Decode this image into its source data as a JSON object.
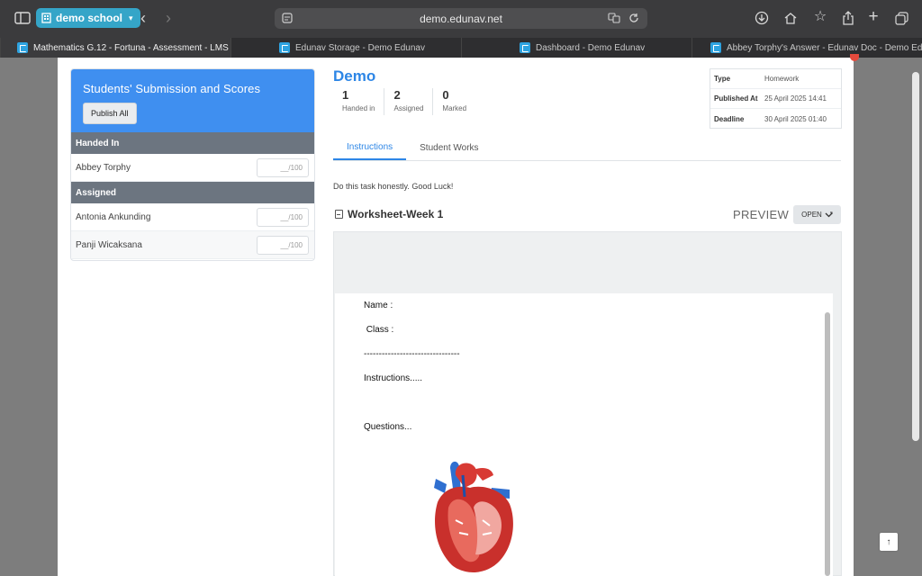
{
  "browser": {
    "profile_label": "demo school",
    "url": "demo.edunav.net",
    "tabs": [
      {
        "label": "Mathematics G.12 - Fortuna - Assessment - LMS -..."
      },
      {
        "label": "Edunav Storage - Demo Edunav"
      },
      {
        "label": "Dashboard - Demo Edunav"
      },
      {
        "label": "Abbey Torphy's Answer - Edunav Doc - Demo Edu..."
      }
    ]
  },
  "panel": {
    "title": "Students' Submission and Scores",
    "publish_label": "Publish All",
    "groups": [
      {
        "label": "Handed In",
        "students": [
          {
            "name": "Abbey Torphy",
            "score": "__/100"
          }
        ]
      },
      {
        "label": "Assigned",
        "students": [
          {
            "name": "Antonia Ankunding",
            "score": "__/100"
          },
          {
            "name": "Panji Wicaksana",
            "score": "__/100"
          }
        ]
      }
    ]
  },
  "assessment": {
    "title": "Demo",
    "stats": [
      {
        "value": "1",
        "label": "Handed in"
      },
      {
        "value": "2",
        "label": "Assigned"
      },
      {
        "value": "0",
        "label": "Marked"
      }
    ],
    "info": [
      {
        "key": "Type",
        "value": "Homework"
      },
      {
        "key": "Published At",
        "value": "25 April 2025 14:41"
      },
      {
        "key": "Deadline",
        "value": "30 April 2025 01:40"
      }
    ],
    "tabs": [
      {
        "label": "Instructions",
        "active": true
      },
      {
        "label": "Student Works",
        "active": false
      }
    ],
    "description": "Do this task honestly. Good Luck!",
    "worksheet": {
      "title": "Worksheet-Week 1",
      "preview_label": "PREVIEW",
      "open_label": "OPEN",
      "lines": [
        "Name :",
        " Class :",
        "--------------------------------",
        "Instructions.....",
        "Questions..."
      ]
    }
  },
  "colors": {
    "accent": "#2d86e6",
    "panel_header": "#3f8ff0",
    "group_header": "#6c7580"
  }
}
